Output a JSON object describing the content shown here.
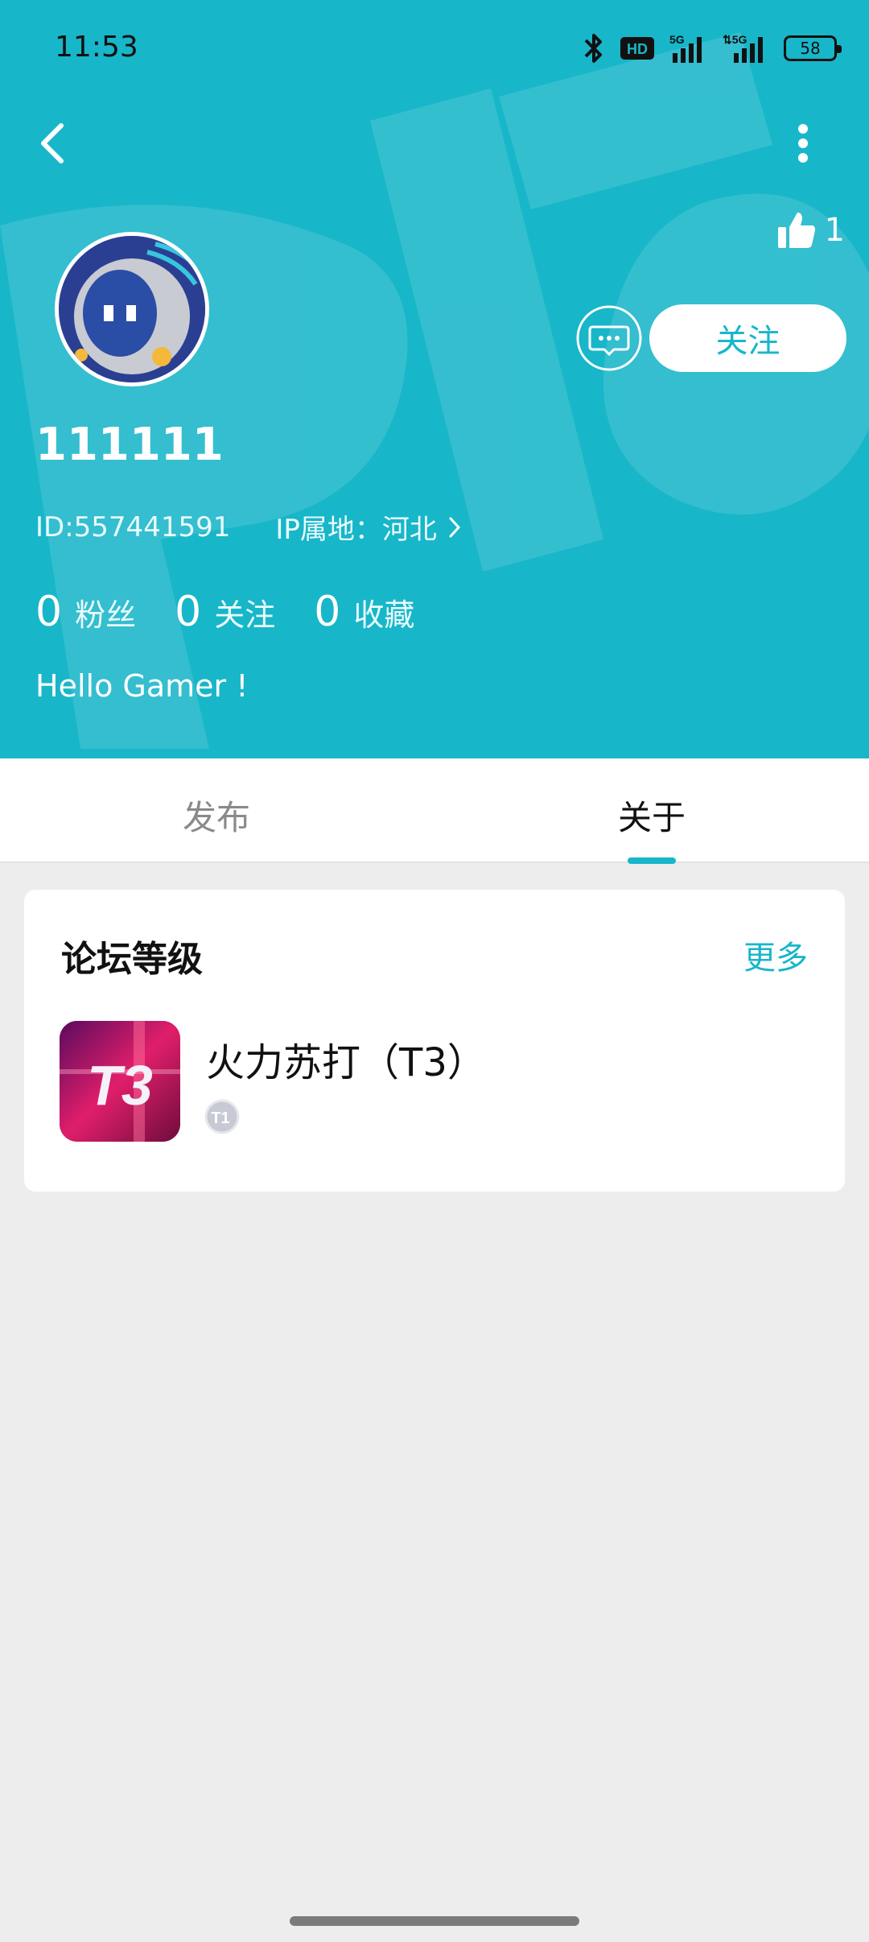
{
  "status_bar": {
    "time": "11:53",
    "battery": "58"
  },
  "header": {
    "likes_count": "1",
    "username": "111111",
    "id_text": "ID:557441591",
    "ip_text": "IP属地：河北",
    "follow_label": "关注",
    "stats": [
      {
        "value": "0",
        "label": "粉丝"
      },
      {
        "value": "0",
        "label": "关注"
      },
      {
        "value": "0",
        "label": "收藏"
      }
    ],
    "bio": "Hello Gamer !"
  },
  "tabs": [
    {
      "label": "发布"
    },
    {
      "label": "关于"
    }
  ],
  "forum_level": {
    "title": "论坛等级",
    "more": "更多",
    "game_name": "火力苏打（T3）",
    "icon_text": "T3",
    "badge_text": "T1"
  },
  "colors": {
    "accent": "#18b6c9",
    "background": "#ededed"
  }
}
